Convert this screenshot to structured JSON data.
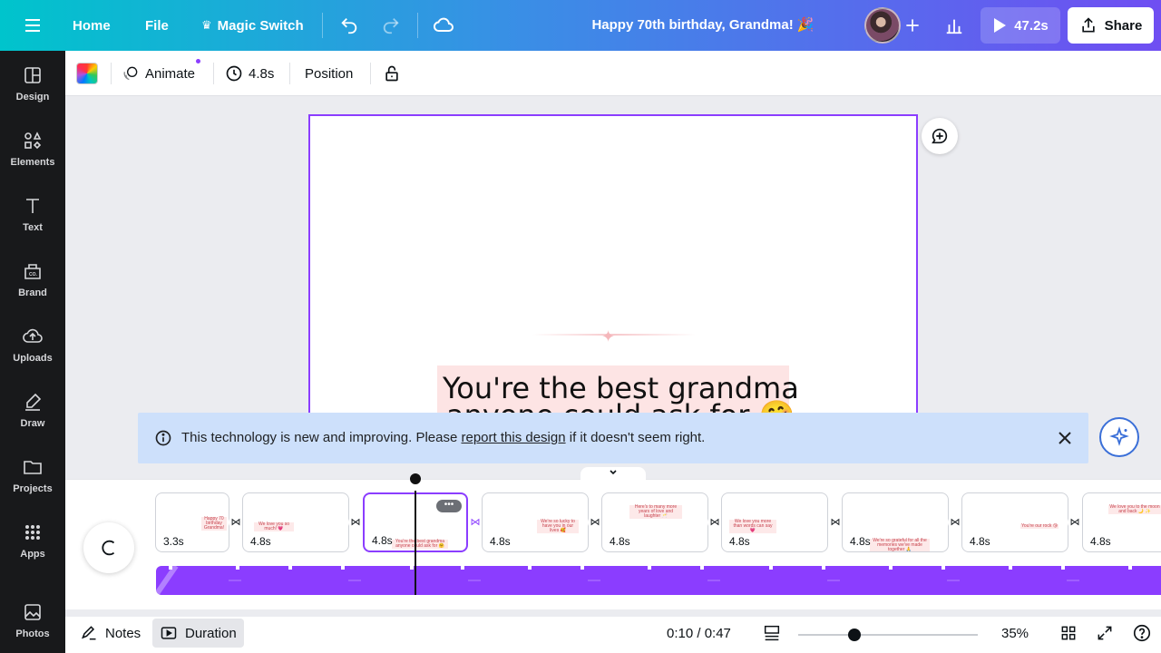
{
  "topbar": {
    "home": "Home",
    "file": "File",
    "magic_switch": "Magic Switch",
    "doc_title": "Happy 70th birthday, Grandma! 🎉",
    "play_duration": "47.2s",
    "share": "Share"
  },
  "sidebar": {
    "items": [
      {
        "label": "Design",
        "icon": "design-icon"
      },
      {
        "label": "Elements",
        "icon": "elements-icon"
      },
      {
        "label": "Text",
        "icon": "text-icon"
      },
      {
        "label": "Brand",
        "icon": "brand-icon"
      },
      {
        "label": "Uploads",
        "icon": "uploads-icon"
      },
      {
        "label": "Draw",
        "icon": "draw-icon"
      },
      {
        "label": "Projects",
        "icon": "projects-icon"
      },
      {
        "label": "Apps",
        "icon": "apps-icon"
      },
      {
        "label": "Photos",
        "icon": "photos-icon"
      }
    ]
  },
  "context_toolbar": {
    "animate": "Animate",
    "duration": "4.8s",
    "position": "Position"
  },
  "canvas": {
    "line1": "You're the best grandma",
    "line2": "anyone could ask for 🤗"
  },
  "banner": {
    "text_before": "This technology is new and improving. Please ",
    "link": "report this design",
    "text_after": " if it doesn't seem right."
  },
  "timeline": {
    "clips": [
      {
        "duration": "3.3s",
        "thumb": "Happy 70 birthday Grandma!"
      },
      {
        "duration": "4.8s",
        "thumb": "We love you so much! 💗"
      },
      {
        "duration": "4.8s",
        "thumb": "You're the best grandma anyone could ask for 🤗"
      },
      {
        "duration": "4.8s",
        "thumb": "We're so lucky to have you in our lives 🥰"
      },
      {
        "duration": "4.8s",
        "thumb": "Here's to many more years of love and laughter 🥂"
      },
      {
        "duration": "4.8s",
        "thumb": "We love you more than words can say 💗"
      },
      {
        "duration": "4.8s",
        "thumb": "We're so grateful for all the memories we've made together 🙏"
      },
      {
        "duration": "4.8s",
        "thumb": "You're our rock 😘"
      },
      {
        "duration": "4.8s",
        "thumb": "We love you to the moon and back 🌙 ✨"
      }
    ]
  },
  "footer": {
    "notes": "Notes",
    "duration": "Duration",
    "time": "0:10 / 0:47",
    "zoom": "35%"
  },
  "colors": {
    "accent": "#8b3dff",
    "banner_bg": "#cde0fb",
    "text_highlight": "#fde4e4"
  }
}
